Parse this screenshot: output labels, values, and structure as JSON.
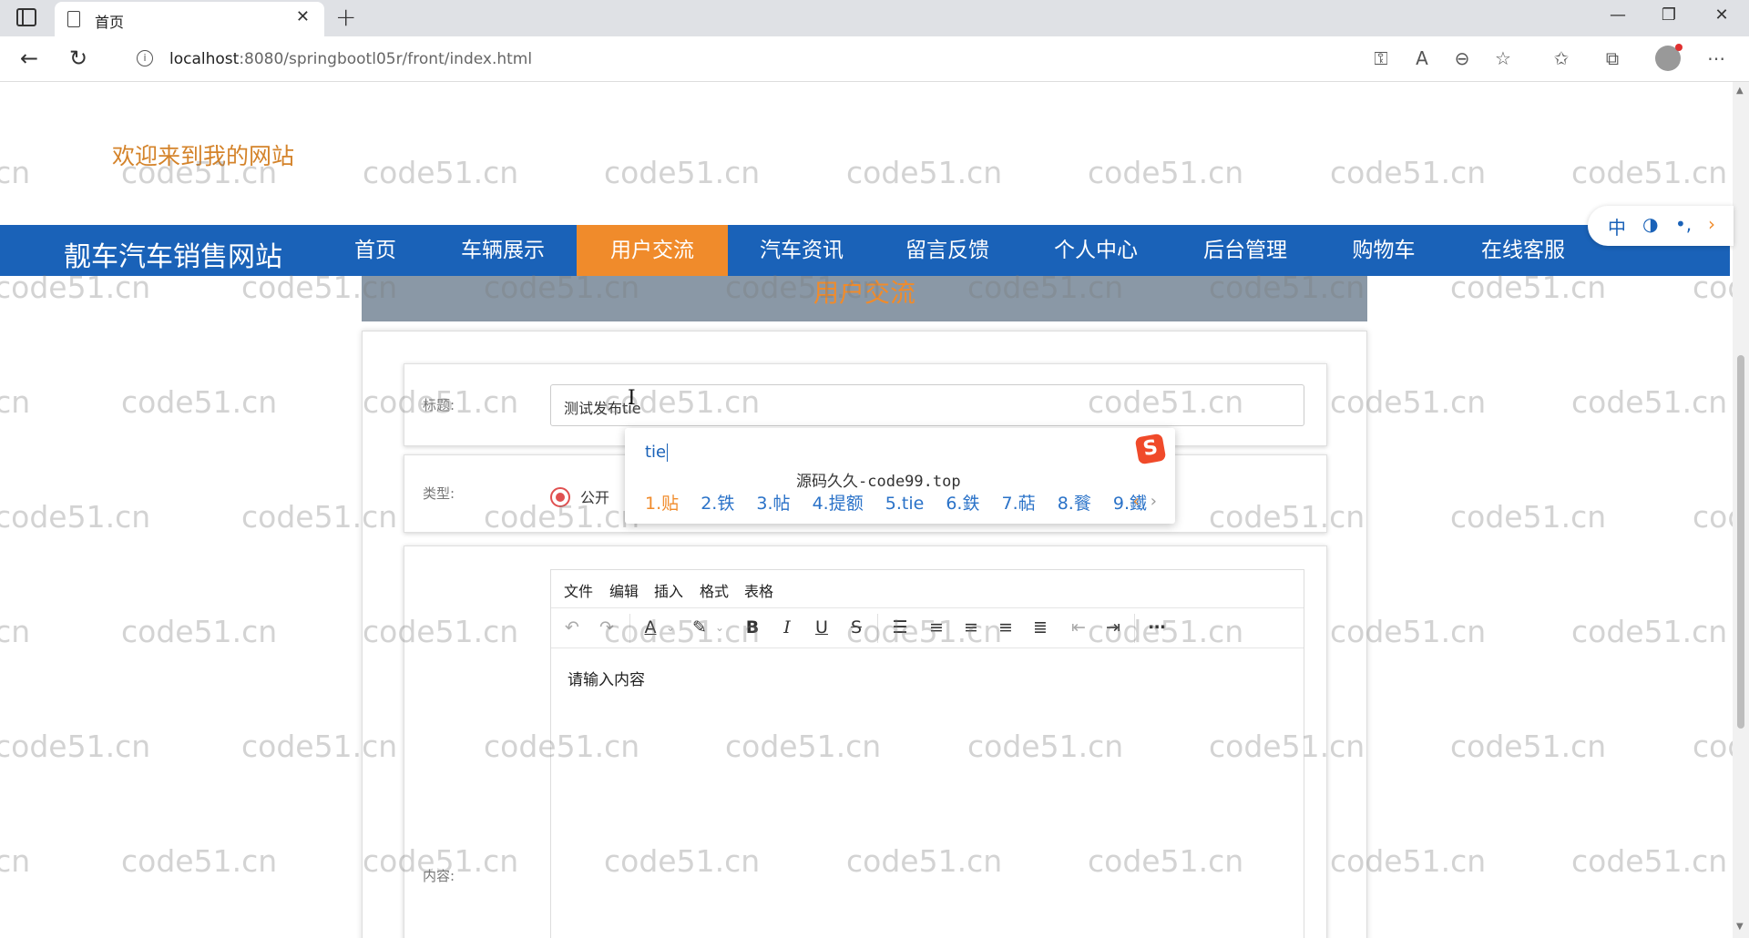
{
  "browser": {
    "tab_title": "首页",
    "tab_close": "✕",
    "new_tab": "+",
    "url_host": "localhost",
    "url_path": ":8080/springbootl05r/front/index.html",
    "window_controls": [
      "—",
      "❐",
      "✕"
    ]
  },
  "site": {
    "welcome": "欢迎来到我的网站",
    "brand": "靓车汽车销售网站",
    "nav": [
      "首页",
      "车辆展示",
      "用户交流",
      "汽车资讯",
      "留言反馈",
      "个人中心",
      "后台管理",
      "购物车",
      "在线客服"
    ],
    "active_nav": "用户交流",
    "accent_color": "#f08b2b",
    "nav_color": "#1a62b8"
  },
  "section": {
    "title": "用户交流"
  },
  "form": {
    "title_label": "标题:",
    "title_value": "测试发布tie",
    "type_label": "类型:",
    "type_option": "公开",
    "content_label": "内容:",
    "editor_menu": [
      "文件",
      "编辑",
      "插入",
      "格式",
      "表格"
    ],
    "editor_placeholder": "请输入内容"
  },
  "ime": {
    "input": "tie",
    "sponsor": "源码久久-code99.top",
    "candidates": [
      "1.贴",
      "2.铁",
      "3.帖",
      "4.提额",
      "5.tie",
      "6.鉄",
      "7.萜",
      "8.餮",
      "9.鐵"
    ],
    "prev": "‹",
    "next": "›",
    "logo": "S",
    "status": [
      "中",
      "◑",
      "•,",
      "›"
    ]
  },
  "watermark": "code51.cn"
}
